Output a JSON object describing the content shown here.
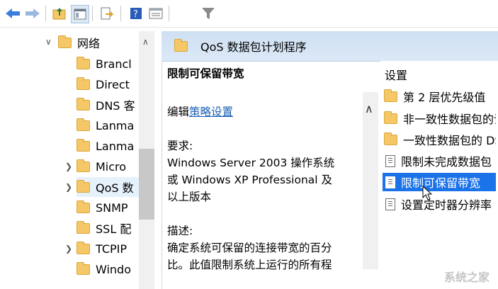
{
  "toolbar": {
    "buttons": [
      "back-icon",
      "forward-icon",
      "up-folder-icon",
      "show-tree-icon",
      "export-icon",
      "help-icon",
      "properties-icon",
      "filter-icon"
    ],
    "help_glyph": "?"
  },
  "tree": {
    "items": [
      {
        "label": "网络",
        "expanded": true
      },
      {
        "label": "Brancl"
      },
      {
        "label": "Direct"
      },
      {
        "label": "DNS 客"
      },
      {
        "label": "Lanma"
      },
      {
        "label": "Lanma"
      },
      {
        "label": "Micro"
      },
      {
        "label": "QoS 数",
        "selected": true
      },
      {
        "label": "SNMP"
      },
      {
        "label": "SSL 配"
      },
      {
        "label": "TCPIP"
      },
      {
        "label": "Windo"
      }
    ]
  },
  "header": {
    "title": "QoS 数据包计划程序"
  },
  "description": {
    "title": "限制可保留带宽",
    "edit_prefix": "编辑",
    "edit_link": "策略设置",
    "req_label": "要求:",
    "req_line1": "Windows Server 2003 操作系统",
    "req_line2": "或 Windows XP Professional 及",
    "req_line3": "以上版本",
    "desc_label": "描述:",
    "desc_line1": "确定系统可保留的连接带宽的百分",
    "desc_line2": "比。此值限制系统上运行的所有程"
  },
  "settings": {
    "heading": "设置",
    "items": [
      {
        "label": "第 2 层优先级值",
        "type": "folder"
      },
      {
        "label": "非一致性数据包的设",
        "type": "folder"
      },
      {
        "label": "一致性数据包的 DSC",
        "type": "folder"
      },
      {
        "label": "限制未完成数据包",
        "type": "policy"
      },
      {
        "label": "限制可保留带宽",
        "type": "policy",
        "selected": true
      },
      {
        "label": "设置定时器分辨率",
        "type": "policy"
      }
    ]
  },
  "watermark": "系统之家"
}
